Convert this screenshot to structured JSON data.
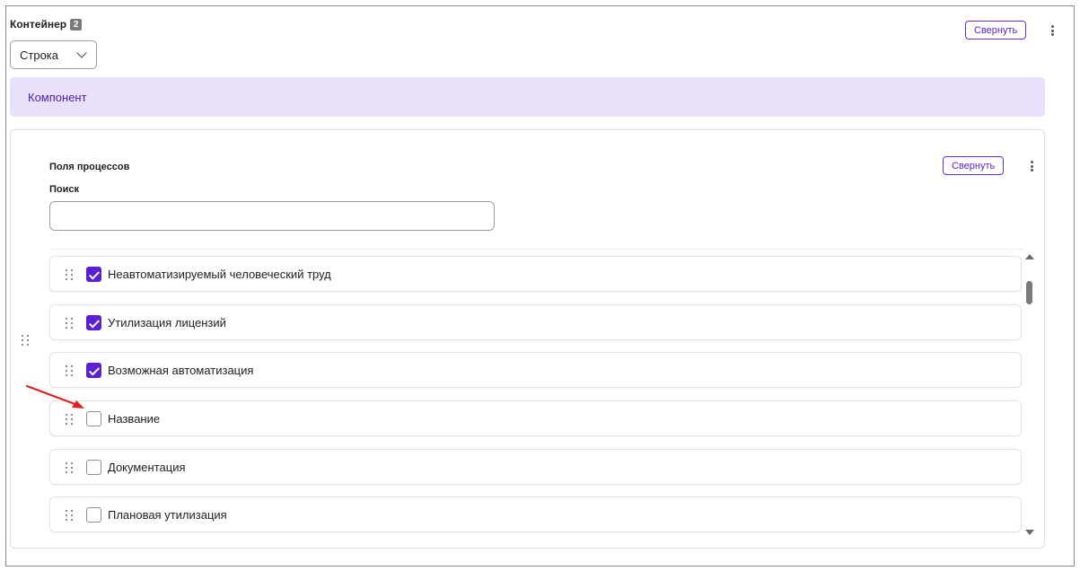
{
  "container": {
    "title": "Контейнер",
    "count": "2",
    "collapse_label": "Свернуть",
    "layout_select": {
      "value": "Строка"
    }
  },
  "component": {
    "title": "Компонент"
  },
  "process_fields": {
    "title": "Поля процессов",
    "collapse_label": "Свернуть",
    "search": {
      "label": "Поиск",
      "value": "",
      "placeholder": ""
    },
    "items": [
      {
        "label": "Неавтоматизируемый человеческий труд",
        "checked": true
      },
      {
        "label": "Утилизация лицензий",
        "checked": true
      },
      {
        "label": "Возможная автоматизация",
        "checked": true
      },
      {
        "label": "Название",
        "checked": false
      },
      {
        "label": "Документация",
        "checked": false
      },
      {
        "label": "Плановая утилизация",
        "checked": false
      }
    ]
  },
  "colors": {
    "accent": "#5a1fd6",
    "component_bg": "#e9e0fb",
    "annotation_arrow": "#e02020"
  },
  "icons": {
    "kebab": "kebab-menu-icon",
    "drag": "drag-handle-icon",
    "chevron": "chevron-down-icon",
    "checkbox": "checkbox-icon",
    "annotation": "red-arrow-icon"
  }
}
